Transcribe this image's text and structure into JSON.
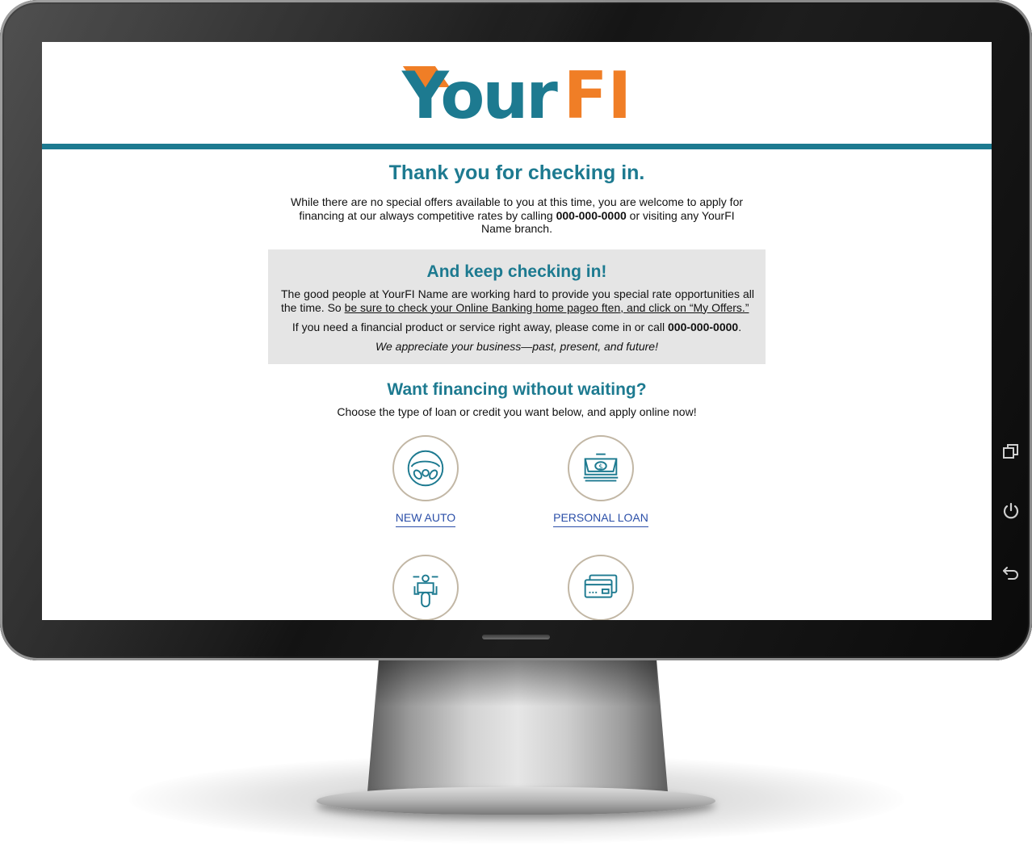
{
  "logo": {
    "part1": "Your",
    "part2": "FI"
  },
  "colors": {
    "brand_teal": "#1d7a90",
    "brand_orange": "#f07e26",
    "link_blue": "#2b4fa8",
    "panel_gray": "#e5e5e5"
  },
  "heading": "Thank you for checking in.",
  "intro": {
    "text_before": "While there are no special offers available to you at this time, you are welcome to apply for financing at our always competitive rates by calling ",
    "phone": "000-000-0000",
    "text_after": " or visiting any YourFI Name branch."
  },
  "keep_box": {
    "heading": "And keep checking in!",
    "p1_before": "The good people at YourFI Name are working hard to provide you special rate opportunities all the time. So ",
    "p1_link": "be sure to check your Online Banking home pageo ften, and click on “My Offers.”",
    "p2_before": "If you need a financial product or service right away, please come in or call ",
    "p2_phone": "000-000-0000",
    "p2_after": ".",
    "p3": "We appreciate your business—past, present, and future!"
  },
  "financing": {
    "heading": "Want financing without waiting?",
    "subheading": "Choose the type of loan or credit you want below, and apply online now!",
    "options": [
      {
        "label": "NEW AUTO",
        "icon": "steering-wheel-icon"
      },
      {
        "label": "PERSONAL LOAN",
        "icon": "cash-dispense-icon"
      },
      {
        "label": "",
        "icon": "motorcycle-icon"
      },
      {
        "label": "",
        "icon": "credit-card-icon"
      }
    ]
  },
  "device_buttons": [
    "recent-apps-icon",
    "power-icon",
    "back-icon"
  ]
}
